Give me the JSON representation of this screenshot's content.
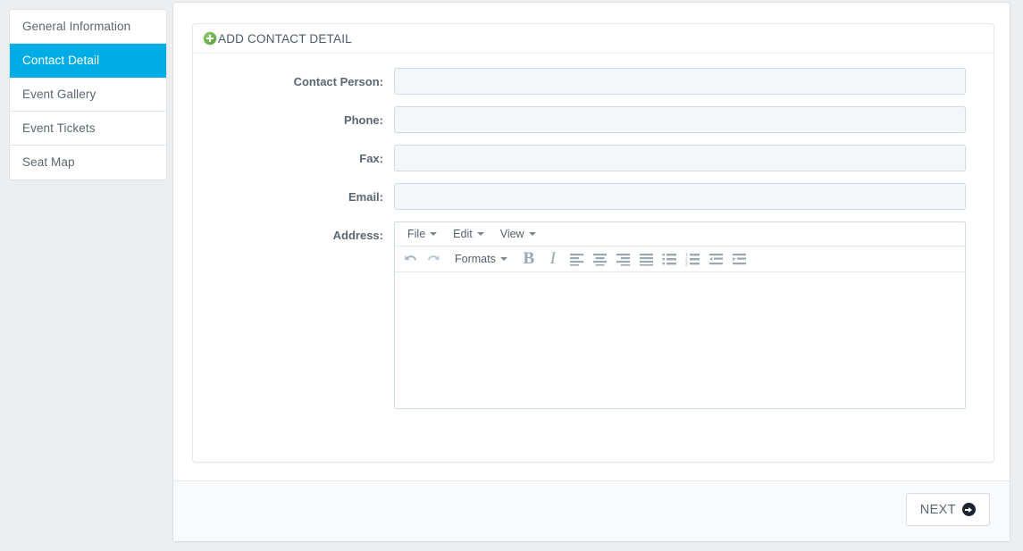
{
  "sidebar": {
    "items": [
      {
        "label": "General Information",
        "active": false
      },
      {
        "label": "Contact Detail",
        "active": true
      },
      {
        "label": "Event Gallery",
        "active": false
      },
      {
        "label": "Event Tickets",
        "active": false
      },
      {
        "label": "Seat Map",
        "active": false
      }
    ]
  },
  "panel": {
    "title": "ADD CONTACT DETAIL",
    "add_icon": "plus-circle-icon"
  },
  "form": {
    "fields": [
      {
        "label": "Contact Person:",
        "value": "",
        "placeholder": "",
        "type": "text",
        "name": "contact-person"
      },
      {
        "label": "Phone:",
        "value": "",
        "placeholder": "",
        "type": "text",
        "name": "phone"
      },
      {
        "label": "Fax:",
        "value": "",
        "placeholder": "",
        "type": "text",
        "name": "fax"
      },
      {
        "label": "Email:",
        "value": "",
        "placeholder": "",
        "type": "text",
        "name": "email"
      }
    ],
    "address": {
      "label": "Address:",
      "value": ""
    }
  },
  "editor": {
    "menus": [
      {
        "label": "File"
      },
      {
        "label": "Edit"
      },
      {
        "label": "View"
      }
    ],
    "formats_label": "Formats",
    "bold_label": "B",
    "italic_label": "I",
    "tools": [
      {
        "name": "undo-icon",
        "title": "Undo"
      },
      {
        "name": "redo-icon",
        "title": "Redo"
      },
      {
        "name": "align-left-icon",
        "title": "Align left"
      },
      {
        "name": "align-center-icon",
        "title": "Align center"
      },
      {
        "name": "align-right-icon",
        "title": "Align right"
      },
      {
        "name": "align-justify-icon",
        "title": "Justify"
      },
      {
        "name": "bullet-list-icon",
        "title": "Bullet list"
      },
      {
        "name": "numbered-list-icon",
        "title": "Numbered list"
      },
      {
        "name": "outdent-icon",
        "title": "Decrease indent"
      },
      {
        "name": "indent-icon",
        "title": "Increase indent"
      }
    ]
  },
  "footer": {
    "next_label": "NEXT",
    "next_icon": "arrow-circle-right-icon"
  },
  "colors": {
    "accent": "#00ace6",
    "page_bg": "#edeef0",
    "panel_bg": "#ffffff",
    "input_bg": "#f3f7f9",
    "input_border": "#cfdbe2",
    "label_text": "#5a6672",
    "add_icon_green": "#6cb04a",
    "next_icon_dark": "#1b2430",
    "footer_bg": "#f9fafc"
  }
}
